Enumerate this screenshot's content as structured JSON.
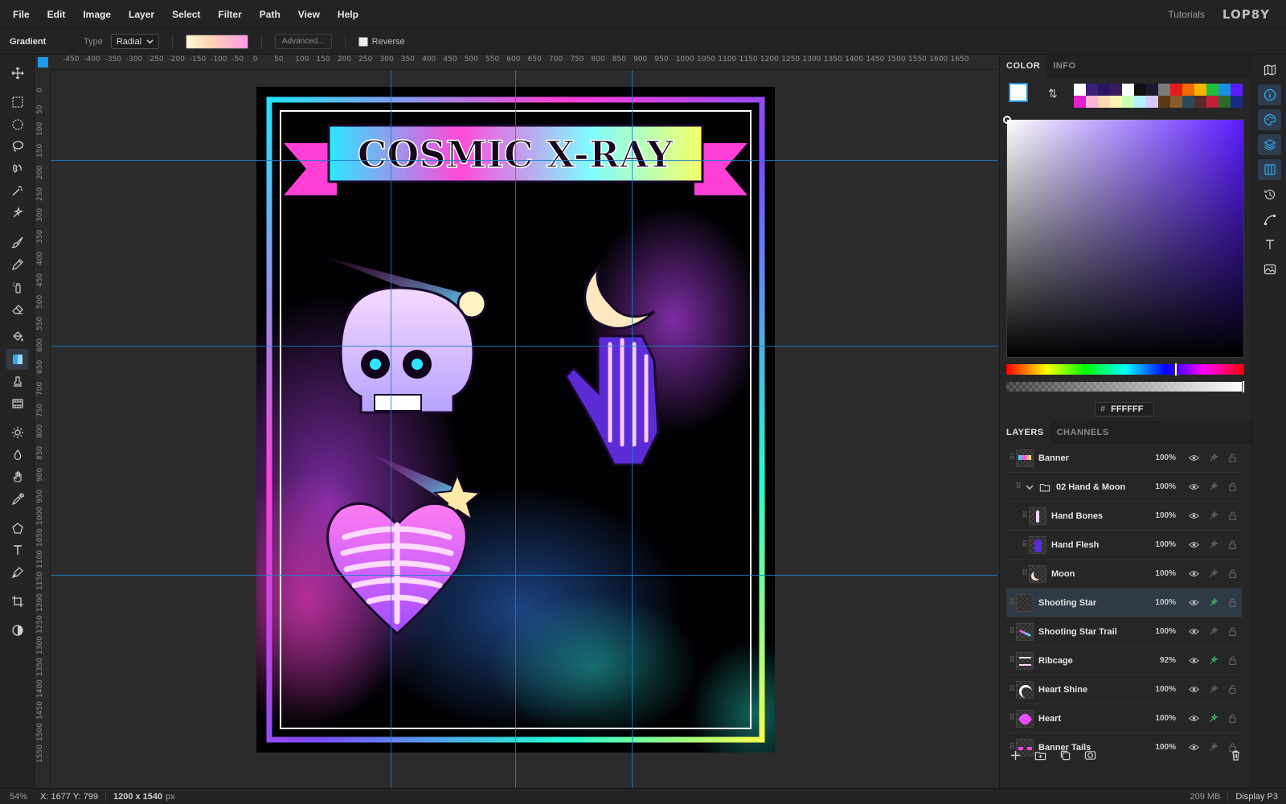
{
  "menu": [
    "File",
    "Edit",
    "Image",
    "Layer",
    "Select",
    "Filter",
    "Path",
    "View",
    "Help"
  ],
  "header": {
    "tutorials": "Tutorials",
    "logo": "LOP8Y"
  },
  "options": {
    "tool_name": "Gradient",
    "type_label": "Type",
    "type_value": "Radial",
    "advanced_label": "Advanced...",
    "reverse_label": "Reverse",
    "reverse_checked": false
  },
  "tools": [
    {
      "name": "move-tool-icon",
      "active": false
    },
    {
      "name": "rect-select-icon",
      "active": false
    },
    {
      "name": "ellipse-select-icon",
      "active": false
    },
    {
      "name": "lasso-icon",
      "active": false
    },
    {
      "name": "magnetic-lasso-icon",
      "active": false
    },
    {
      "name": "magic-wand-icon",
      "active": false
    },
    {
      "name": "quick-select-icon",
      "active": false
    },
    {
      "name": "brush-icon",
      "active": false
    },
    {
      "name": "pencil-icon",
      "active": false
    },
    {
      "name": "spray-icon",
      "active": false
    },
    {
      "name": "eraser-icon",
      "active": false
    },
    {
      "name": "bucket-icon",
      "active": false
    },
    {
      "name": "gradient-icon",
      "active": true
    },
    {
      "name": "stamp-icon",
      "active": false
    },
    {
      "name": "filmstrip-icon",
      "active": false
    },
    {
      "name": "dodge-icon",
      "active": false
    },
    {
      "name": "smudge-icon",
      "active": false
    },
    {
      "name": "hand-icon",
      "active": false
    },
    {
      "name": "eyedropper-icon",
      "active": false
    },
    {
      "name": "polygon-icon",
      "active": false
    },
    {
      "name": "text-tool-icon",
      "active": false
    },
    {
      "name": "pen-icon",
      "active": false
    },
    {
      "name": "crop-icon",
      "active": false
    },
    {
      "name": "contrast-icon",
      "active": false
    }
  ],
  "ruler_top": [
    "-450",
    "-400",
    "-350",
    "-300",
    "-250",
    "-200",
    "-150",
    "-100",
    "-50",
    "0",
    "50",
    "100",
    "150",
    "200",
    "250",
    "300",
    "350",
    "400",
    "450",
    "500",
    "550",
    "600",
    "650",
    "700",
    "750",
    "800",
    "850",
    "900",
    "950",
    "1000",
    "1050",
    "1100",
    "1150",
    "1200",
    "1250",
    "1300",
    "1350",
    "1400",
    "1450",
    "1500",
    "1550",
    "1600",
    "1650"
  ],
  "ruler_left": [
    "0",
    "50",
    "100",
    "150",
    "200",
    "250",
    "300",
    "350",
    "400",
    "450",
    "500",
    "550",
    "600",
    "650",
    "700",
    "750",
    "800",
    "850",
    "900",
    "950",
    "1000",
    "1050",
    "1100",
    "1150",
    "1200",
    "1250",
    "1300",
    "1350",
    "1400",
    "1450",
    "1500",
    "1550"
  ],
  "artwork": {
    "title": "COSMIC X-RAY"
  },
  "color_panel": {
    "tabs": [
      "COLOR",
      "INFO"
    ],
    "fg_color": "#FFFFFF",
    "hex_value": "FFFFFF",
    "swatches": [
      "#ffffff",
      "#3b1e7a",
      "#2a1560",
      "#3a1a5c",
      "#ffffff",
      "#111111",
      "#1a1a2a",
      "#7a7a7a",
      "#e21c1c",
      "#f06a00",
      "#f5b400",
      "#1fbf3a",
      "#1a8fe0",
      "#5a1cff",
      "#e020c8",
      "#ffb3d9",
      "#ffd9b3",
      "#fff5b3",
      "#c8ffb3",
      "#b3f0ff",
      "#d9c8ff",
      "#5a3a1a",
      "#8a5a2a",
      "#2a4a5a",
      "#5a2a2a",
      "#c0203a",
      "#2a6a2a",
      "#1a2a8a"
    ]
  },
  "layers_panel": {
    "tabs": [
      "LAYERS",
      "CHANNELS"
    ],
    "layers": [
      {
        "name": "Banner",
        "opacity": "100%",
        "indent": 0,
        "group": false,
        "selected": false,
        "thumb": "banner"
      },
      {
        "name": "02 Hand & Moon",
        "opacity": "100%",
        "indent": 1,
        "group": true,
        "selected": false,
        "thumb": "folder"
      },
      {
        "name": "Hand Bones",
        "opacity": "100%",
        "indent": 2,
        "group": false,
        "selected": false,
        "thumb": "bones"
      },
      {
        "name": "Hand Flesh",
        "opacity": "100%",
        "indent": 2,
        "group": false,
        "selected": false,
        "thumb": "flesh"
      },
      {
        "name": "Moon",
        "opacity": "100%",
        "indent": 2,
        "group": false,
        "selected": false,
        "thumb": "moon"
      },
      {
        "name": "Shooting Star",
        "opacity": "100%",
        "indent": 0,
        "group": false,
        "selected": true,
        "thumb": "empty"
      },
      {
        "name": "Shooting Star Trail",
        "opacity": "100%",
        "indent": 0,
        "group": false,
        "selected": false,
        "thumb": "trail"
      },
      {
        "name": "Ribcage",
        "opacity": "92%",
        "indent": 0,
        "group": false,
        "selected": false,
        "thumb": "ribcage"
      },
      {
        "name": "Heart Shine",
        "opacity": "100%",
        "indent": 0,
        "group": false,
        "selected": false,
        "thumb": "shine"
      },
      {
        "name": "Heart",
        "opacity": "100%",
        "indent": 0,
        "group": false,
        "selected": false,
        "thumb": "heart"
      },
      {
        "name": "Banner Tails",
        "opacity": "100%",
        "indent": 0,
        "group": false,
        "selected": false,
        "thumb": "tails"
      }
    ]
  },
  "status": {
    "zoom": "54%",
    "coords": "X: 1677 Y: 799",
    "dims": "1200 x 1540",
    "dims_unit": "px",
    "memory": "209 MB",
    "profile": "Display P3"
  }
}
